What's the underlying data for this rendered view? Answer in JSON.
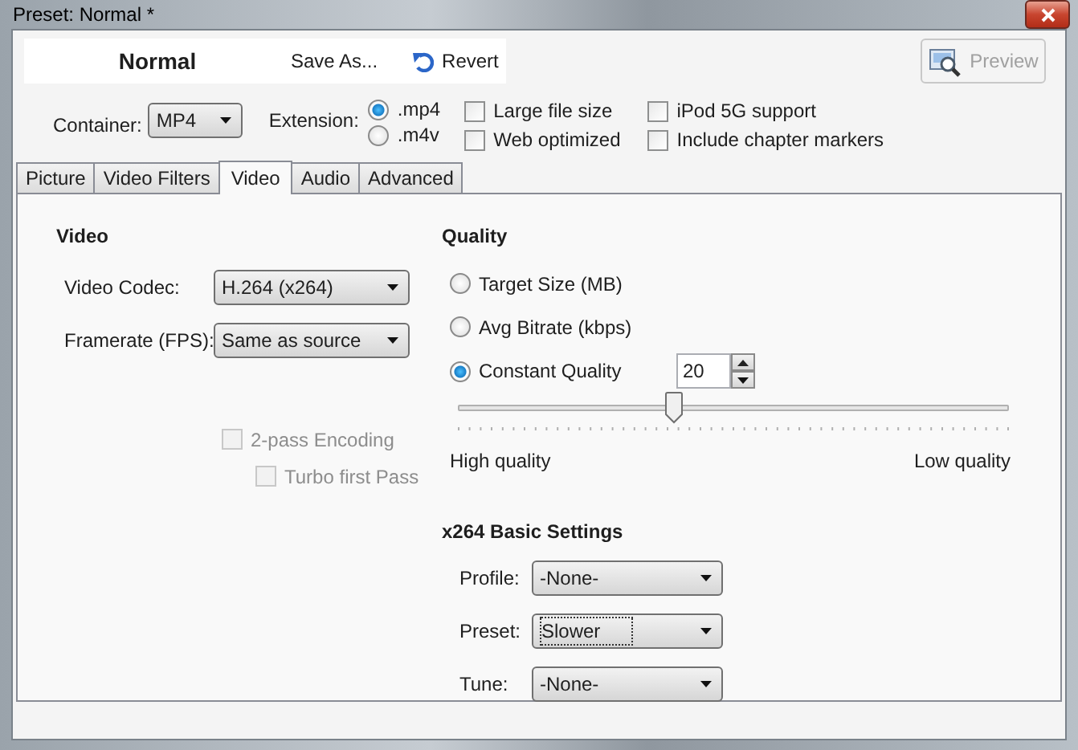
{
  "window": {
    "title": "Preset: Normal *"
  },
  "toolbar": {
    "preset_name": "Normal",
    "buttons": [
      {
        "label": "Save As...",
        "kind": "text"
      },
      {
        "label": "Revert",
        "kind": "revert"
      }
    ],
    "preview": {
      "label": "Preview",
      "disabled": true
    }
  },
  "output": {
    "container": {
      "label": "Container:",
      "value": "MP4"
    },
    "extension": {
      "label": "Extension:",
      "options": [
        {
          "label": ".mp4",
          "selected": true
        },
        {
          "label": ".m4v",
          "selected": false
        }
      ]
    },
    "options": [
      {
        "label": "Large file size",
        "checked": false
      },
      {
        "label": "Web optimized",
        "checked": false
      },
      {
        "label": "iPod 5G support",
        "checked": false
      },
      {
        "label": "Include chapter markers",
        "checked": false
      }
    ]
  },
  "tabs": [
    {
      "label": "Picture",
      "selected": false
    },
    {
      "label": "Video Filters",
      "selected": false
    },
    {
      "label": "Video",
      "selected": true
    },
    {
      "label": "Audio",
      "selected": false
    },
    {
      "label": "Advanced",
      "selected": false
    }
  ],
  "video": {
    "heading": "Video",
    "fields": [
      {
        "label": "Video Codec:",
        "value": "H.264 (x264)"
      },
      {
        "label": "Framerate (FPS):",
        "value": "Same as source"
      }
    ],
    "checks": [
      {
        "label": "2-pass Encoding",
        "checked": false,
        "disabled": true
      },
      {
        "label": "Turbo first Pass",
        "checked": false,
        "disabled": true
      }
    ]
  },
  "quality": {
    "heading": "Quality",
    "modes": [
      {
        "label": "Target Size (MB)",
        "selected": false
      },
      {
        "label": "Avg Bitrate (kbps)",
        "selected": false
      },
      {
        "label": "Constant Quality",
        "selected": true
      }
    ],
    "value": "20",
    "slider": {
      "level": 0.39
    },
    "min_label": "High quality",
    "max_label": "Low quality"
  },
  "x264": {
    "heading": "x264 Basic Settings",
    "fields": [
      {
        "label": "Profile:",
        "value": "-None-",
        "focused": false
      },
      {
        "label": "Preset:",
        "value": "Slower",
        "focused": true
      },
      {
        "label": "Tune:",
        "value": "-None-",
        "focused": false
      }
    ]
  }
}
